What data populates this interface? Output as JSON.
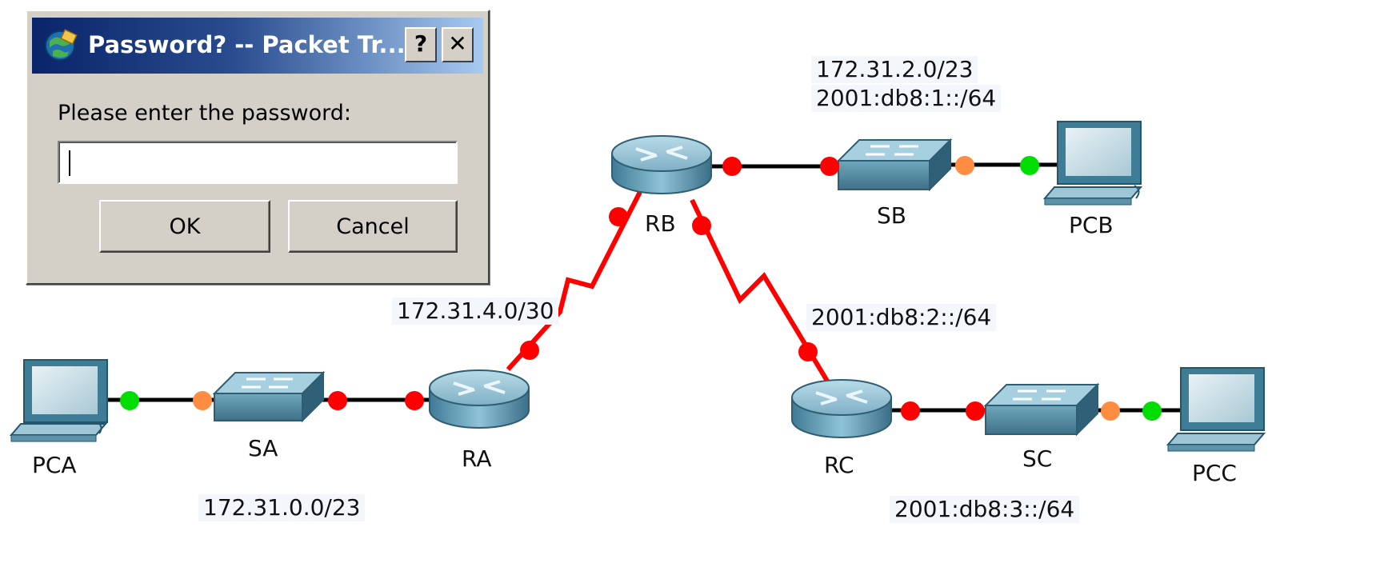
{
  "dialog": {
    "title": "Password? -- Packet Tr...",
    "help_label": "?",
    "close_label": "✕",
    "prompt": "Please enter the password:",
    "password_value": "",
    "ok_label": "OK",
    "cancel_label": "Cancel"
  },
  "topology": {
    "devices": {
      "pca": "PCA",
      "sa": "SA",
      "ra": "RA",
      "rb": "RB",
      "sb": "SB",
      "pcb": "PCB",
      "rc": "RC",
      "sc": "SC",
      "pcc": "PCC"
    },
    "networks": {
      "rb_sb_v4": "172.31.2.0/23",
      "rb_sb_v6": "2001:db8:1::/64",
      "ra_rb": "172.31.4.0/30",
      "rb_rc": "2001:db8:2::/64",
      "lan_a": "172.31.0.0/23",
      "lan_c": "2001:db8:3::/64"
    },
    "colors": {
      "link_up": "#00dd00",
      "link_down": "#ff0000",
      "link_pending": "#ff8c40",
      "serial_link": "#ff0000",
      "ethernet_link": "#000000"
    }
  }
}
